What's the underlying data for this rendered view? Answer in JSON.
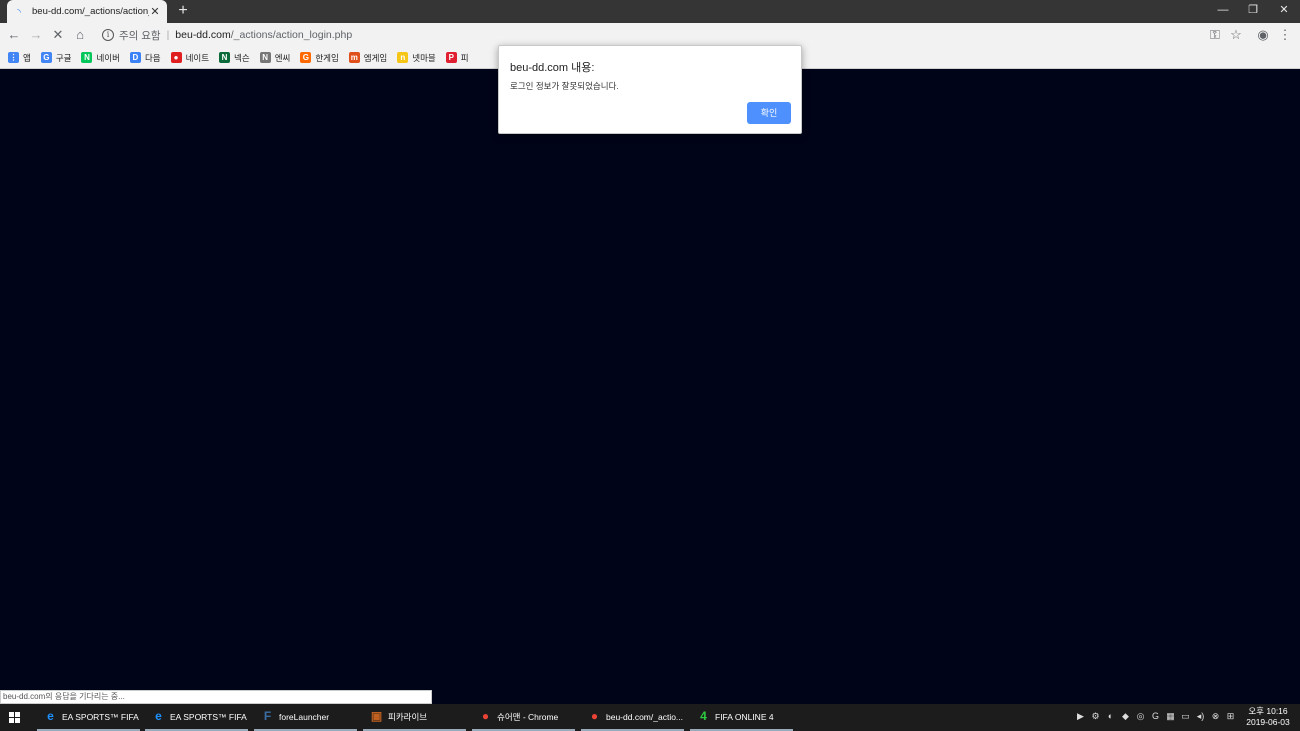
{
  "tab": {
    "title": "beu-dd.com/_actions/action_login",
    "close": "✕"
  },
  "new_tab": "+",
  "window": {
    "minimize": "—",
    "restore": "❐",
    "close": "✕"
  },
  "nav": {
    "back": "←",
    "forward": "→",
    "stop": "✕",
    "home": "⌂"
  },
  "omnibox": {
    "security_icon": "i",
    "security_label": "주의 요함",
    "separator": "|",
    "host": "beu-dd.com",
    "path": "/_actions/action_login.php"
  },
  "toolbar_icons": {
    "key": "⚿",
    "star": "☆",
    "account": "◉",
    "menu": "⋮"
  },
  "bookmarks": [
    {
      "label": "앱",
      "icon": "apps-icon",
      "color": "#4285f4",
      "glyph": "⋮"
    },
    {
      "label": "구글",
      "icon": "google-icon",
      "color": "#4285f4",
      "glyph": "G"
    },
    {
      "label": "네이버",
      "icon": "naver-icon",
      "color": "#03c75a",
      "glyph": "N"
    },
    {
      "label": "다음",
      "icon": "daum-icon",
      "color": "#3b82f6",
      "glyph": "D"
    },
    {
      "label": "네이트",
      "icon": "nate-icon",
      "color": "#e02020",
      "glyph": "●"
    },
    {
      "label": "넥슨",
      "icon": "nexon-icon",
      "color": "#0a6a3a",
      "glyph": "N"
    },
    {
      "label": "엔씨",
      "icon": "nc-icon",
      "color": "#777777",
      "glyph": "N"
    },
    {
      "label": "한게임",
      "icon": "hangame-icon",
      "color": "#ff6a00",
      "glyph": "G"
    },
    {
      "label": "엠게임",
      "icon": "mgame-icon",
      "color": "#e0501a",
      "glyph": "m"
    },
    {
      "label": "넷마블",
      "icon": "netmarble-icon",
      "color": "#f5c518",
      "glyph": "n"
    },
    {
      "label": "피",
      "icon": "pmang-icon",
      "color": "#e02030",
      "glyph": "P"
    }
  ],
  "dialog": {
    "title": "beu-dd.com 내용:",
    "message": "로그인 정보가 잘못되었습니다.",
    "ok_label": "확인"
  },
  "status_bar": "beu-dd.com의 응답을 기다리는 중...",
  "taskbar": {
    "tasks": [
      {
        "label": "EA SPORTS™ FIFA ...",
        "icon": "ie-icon",
        "glyph": "e",
        "color": "#1e90ff"
      },
      {
        "label": "EA SPORTS™ FIFA ...",
        "icon": "ie-icon",
        "glyph": "e",
        "color": "#1e90ff"
      },
      {
        "label": "foreLauncher",
        "icon": "forelauncher-icon",
        "glyph": "F",
        "color": "#3a6ea5"
      },
      {
        "label": "피카라이브",
        "icon": "pikalive-icon",
        "glyph": "▣",
        "color": "#c06020"
      },
      {
        "label": "슈어맨 - Chrome",
        "icon": "chrome-icon",
        "glyph": "●",
        "color": "#ea4335"
      },
      {
        "label": "beu-dd.com/_actio...",
        "icon": "chrome-icon",
        "glyph": "●",
        "color": "#ea4335"
      },
      {
        "label": "FIFA ONLINE 4",
        "icon": "fifa-icon",
        "glyph": "4",
        "color": "#2ecc40"
      }
    ],
    "tray": [
      "▶",
      "⚙",
      "◐",
      "◆",
      "◎",
      "G",
      "▦",
      "▭",
      "◂)",
      "⊗",
      "⊞"
    ],
    "clock_time": "오후 10:16",
    "clock_date": "2019-06-03"
  }
}
